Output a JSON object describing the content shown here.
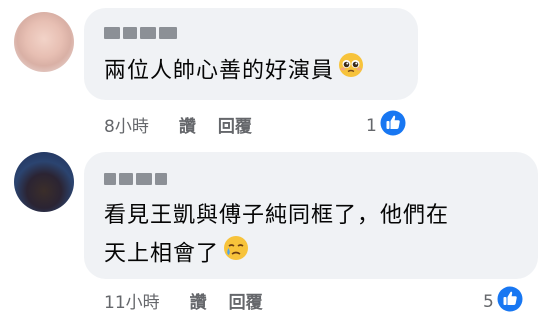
{
  "comments": [
    {
      "author": "",
      "text_lines": [
        "兩位人帥心善的好演員"
      ],
      "emoji": "pleading-face",
      "time": "8小時",
      "like_label": "讚",
      "reply_label": "回覆",
      "reaction_count": "1",
      "reaction_icon": "thumbs-up-icon"
    },
    {
      "author": "",
      "text_lines": [
        "看見王凱與傅子純同框了，他們在",
        "天上相會了"
      ],
      "emoji": "crying-face",
      "time": "11小時",
      "like_label": "讚",
      "reply_label": "回覆",
      "reaction_count": "5",
      "reaction_icon": "thumbs-up-icon"
    }
  ],
  "colors": {
    "bubble": "#f0f2f5",
    "meta_text": "#65676b",
    "like_blue": "#1877f2"
  }
}
